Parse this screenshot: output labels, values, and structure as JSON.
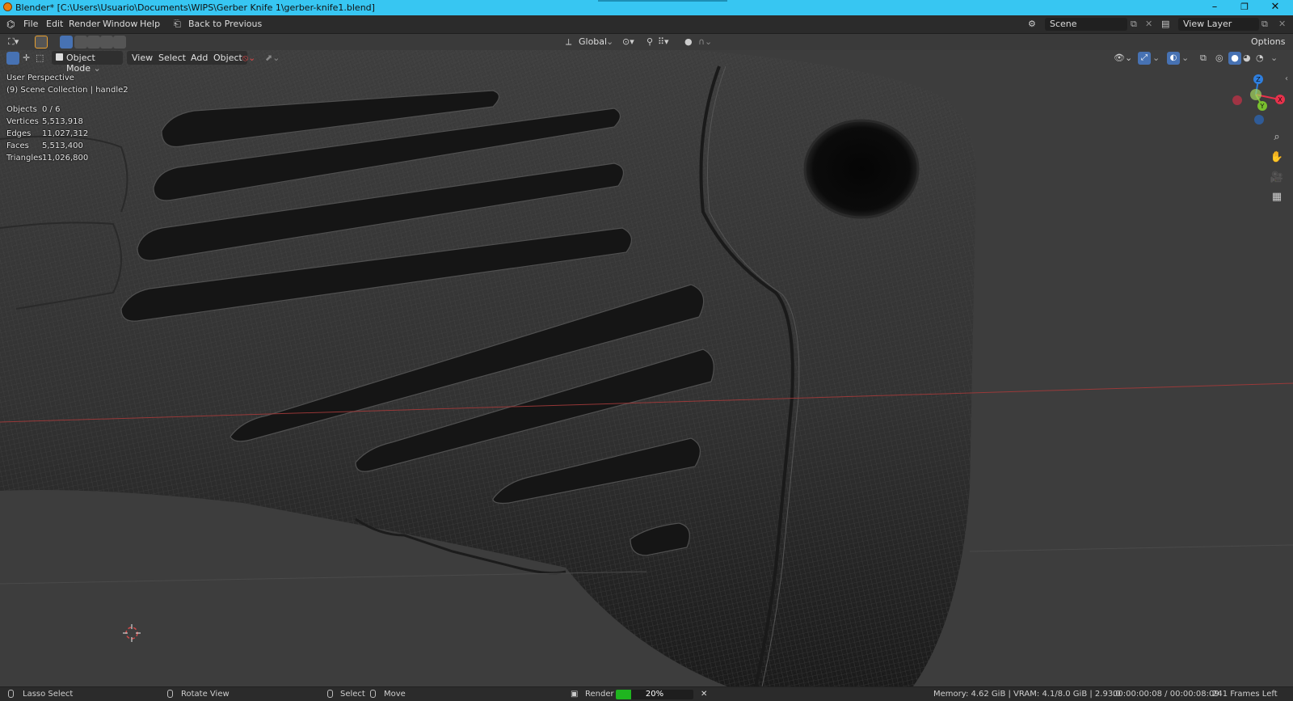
{
  "titlebar": {
    "title": "Blender* [C:\\Users\\Usuario\\Documents\\WIPS\\Gerber Knife 1\\gerber-knife1.blend]",
    "minimize": "–",
    "maximize": "❐",
    "close": "✕"
  },
  "menubar": {
    "items": [
      "File",
      "Edit",
      "Render",
      "Window",
      "Help"
    ],
    "back_to_previous": "Back to Previous",
    "scene": "Scene",
    "view_layer": "View Layer"
  },
  "toolheader": {
    "orientation": "Global",
    "options": "Options"
  },
  "viewport_header": {
    "mode": "Object Mode",
    "menus": [
      "View",
      "Select",
      "Add",
      "Object"
    ]
  },
  "overlay": {
    "perspective": "User Perspective",
    "collection": "(9) Scene Collection | handle2",
    "stats": [
      {
        "label": "Objects",
        "value": "0 / 6"
      },
      {
        "label": "Vertices",
        "value": "5,513,918"
      },
      {
        "label": "Edges",
        "value": "11,027,312"
      },
      {
        "label": "Faces",
        "value": "5,513,400"
      },
      {
        "label": "Triangles",
        "value": "11,026,800"
      }
    ]
  },
  "gizmo": {
    "z": "Z",
    "y": "Y",
    "x": "X"
  },
  "statusbar": {
    "lasso": "Lasso Select",
    "rotate": "Rotate View",
    "select": "Select",
    "move": "Move",
    "render": "Render",
    "progress_text": "20%",
    "progress_value": 0.2,
    "memory": "Memory: 4.62 GiB | VRAM: 4.1/8.0 GiB | 2.93.0",
    "time": "00:00:00:08 / 00:00:08:09",
    "frames_left": "241 Frames Left"
  },
  "colors": {
    "titlebar": "#37c6f2",
    "accent_blue": "#4772b3",
    "axis_x": "#e8314b",
    "axis_y": "#79c02e",
    "axis_z": "#2e7fe0",
    "progress": "#1fb51f"
  }
}
